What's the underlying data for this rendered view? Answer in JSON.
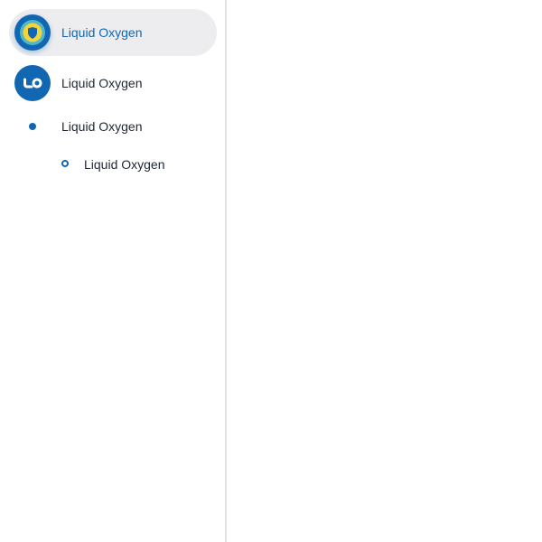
{
  "sidebar": {
    "items": [
      {
        "label": "Liquid Oxygen",
        "icon": "shield-logo-icon",
        "active": true
      },
      {
        "label": "Liquid Oxygen",
        "icon": "lo-logo-icon",
        "active": false
      },
      {
        "label": "Liquid Oxygen",
        "icon": "filled-dot-icon",
        "active": false
      },
      {
        "label": "Liquid Oxygen",
        "icon": "ring-dot-icon",
        "active": false
      }
    ]
  },
  "colors": {
    "accent": "#1167b1",
    "active_background": "#ededf0",
    "divider": "#e3e4e7",
    "text": "#1f2633",
    "logo_yellow": "#f5d33a",
    "logo_teal": "#4fb8c9"
  }
}
